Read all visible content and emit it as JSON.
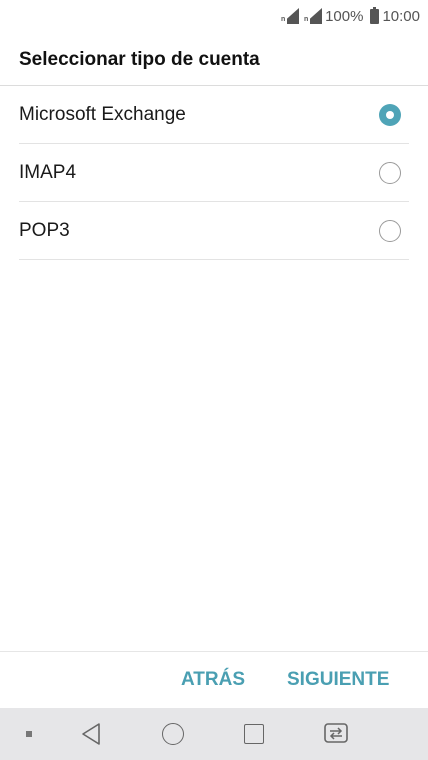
{
  "status_bar": {
    "sim1_label": "n",
    "sim2_label": "n",
    "battery_percent": "100%",
    "time": "10:00"
  },
  "header": {
    "title": "Seleccionar tipo de cuenta"
  },
  "account_types": [
    {
      "label": "Microsoft Exchange",
      "selected": true
    },
    {
      "label": "IMAP4",
      "selected": false
    },
    {
      "label": "POP3",
      "selected": false
    }
  ],
  "actions": {
    "back_label": "ATRÁS",
    "next_label": "SIGUIENTE"
  },
  "colors": {
    "accent": "#4a9fb2",
    "radio_selected": "#4fa4b7",
    "nav_bar_bg": "#e6e6e8"
  },
  "nav_bar": {
    "icons": [
      "dot-icon",
      "back-icon",
      "home-icon",
      "recent-apps-icon",
      "switch-sim-icon"
    ]
  }
}
